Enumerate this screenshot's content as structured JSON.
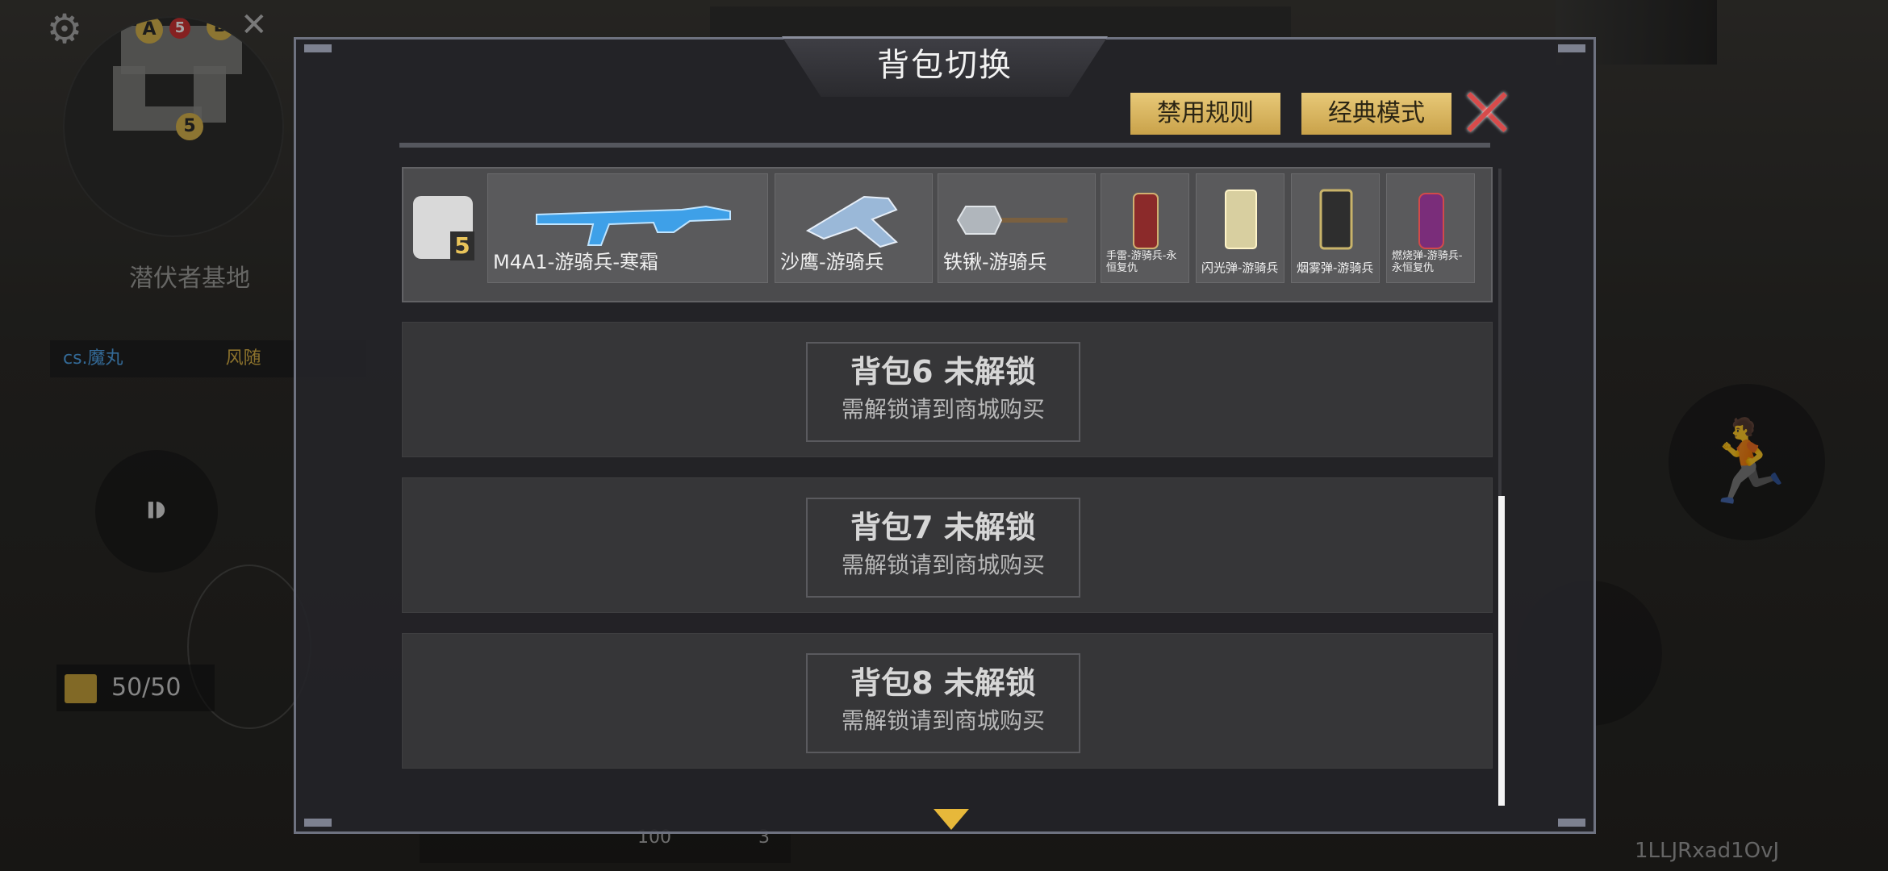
{
  "hud": {
    "minimap_markers": [
      "A",
      "5",
      "B",
      "5"
    ],
    "map_name": "潜伏者基地",
    "kill_feed": {
      "killer": "cs.魔丸",
      "victim": "风随"
    },
    "ammo": "50/50",
    "player_id": "1LLJRxad1OvJ",
    "bottom_health": "100",
    "bottom_armor": "100",
    "bottom_grenades": "3"
  },
  "modal": {
    "title": "背包切换",
    "btn_ban_rules": "禁用规则",
    "btn_classic_mode": "经典模式",
    "current_pack": {
      "number": "5",
      "slots": [
        {
          "label": "M4A1-游骑兵-寒霜",
          "art": "rifle-icon",
          "color": "#3ea0e8"
        },
        {
          "label": "沙鹰-游骑兵",
          "art": "pistol-icon",
          "color": "#9ab8d8"
        },
        {
          "label": "铁锹-游骑兵",
          "art": "shovel-icon",
          "color": "#b0b6bc"
        },
        {
          "label": "手雷-游骑兵-永恒复仇",
          "art": "grenade-icon",
          "color": "#8b2a2a"
        },
        {
          "label": "闪光弹-游骑兵",
          "art": "flashbang-icon",
          "color": "#d8cfa0"
        },
        {
          "label": "烟雾弹-游骑兵",
          "art": "smoke-icon",
          "color": "#8a8070"
        },
        {
          "label": "燃烧弹-游骑兵-永恒复仇",
          "art": "molotov-icon",
          "color": "#7a2d7a"
        }
      ]
    },
    "locked_packs": [
      {
        "title": "背包6 未解锁",
        "subtitle": "需解锁请到商城购买"
      },
      {
        "title": "背包7 未解锁",
        "subtitle": "需解锁请到商城购买"
      },
      {
        "title": "背包8 未解锁",
        "subtitle": "需解锁请到商城购买"
      }
    ]
  }
}
